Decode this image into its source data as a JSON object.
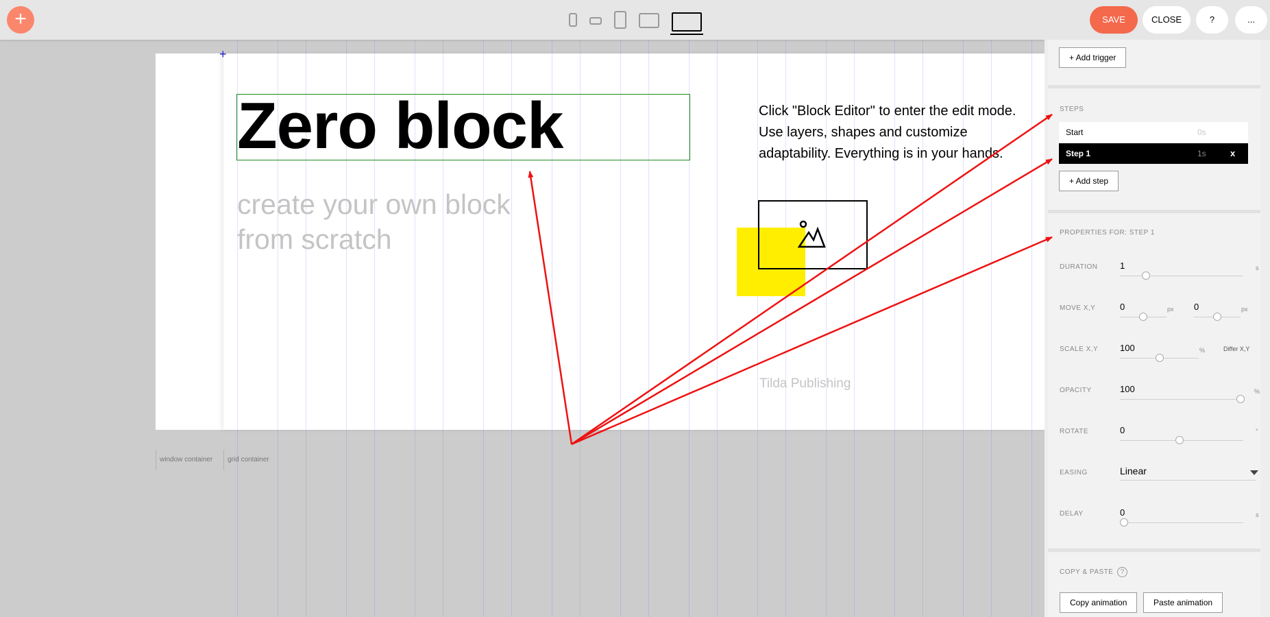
{
  "toolbar": {
    "add_icon": "plus-icon",
    "add_glyph": "+",
    "devices": [
      "phone-portrait-icon",
      "phone-landscape-icon",
      "tablet-portrait-icon",
      "tablet-landscape-icon",
      "desktop-icon"
    ],
    "save_label": "SAVE",
    "close_label": "CLOSE",
    "help_label": "?",
    "more_label": "...",
    "accent_color": "#f4684c"
  },
  "canvas": {
    "crosshair_glyph": "+",
    "title": "Zero block",
    "subtitle": "create your own block from scratch",
    "description": "Click \"Block Editor\" to enter the edit mode. Use layers, shapes and customize adaptability. Everything is in your hands.",
    "footer_text": "Tilda Publishing",
    "shape_color": "#ffee00",
    "window_container_label": "window container",
    "grid_container_label": "grid container"
  },
  "panel": {
    "add_trigger_label": "+ Add trigger",
    "steps_title": "STEPS",
    "steps": [
      {
        "name": "Start",
        "time": "0s"
      },
      {
        "name": "Step 1",
        "time": "1s",
        "delete": "x"
      }
    ],
    "add_step_label": "+ Add step",
    "properties_title": "PROPERTIES FOR: STEP 1",
    "duration": {
      "label": "DURATION",
      "value": "1",
      "unit": "s"
    },
    "move": {
      "label": "MOVE X,Y",
      "x": "0",
      "y": "0",
      "unit": "px"
    },
    "scale": {
      "label": "SCALE X,Y",
      "value": "100",
      "unit": "%",
      "differ_label": "Differ X,Y"
    },
    "opacity": {
      "label": "OPACITY",
      "value": "100",
      "unit": "%"
    },
    "rotate": {
      "label": "ROTATE",
      "value": "0",
      "unit": "°"
    },
    "easing": {
      "label": "EASING",
      "value": "Linear"
    },
    "delay": {
      "label": "DELAY",
      "value": "0",
      "unit": "s"
    },
    "copy_paste_title": "COPY & PASTE",
    "copy_paste_help": "?",
    "copy_label": "Copy animation",
    "paste_label": "Paste animation"
  }
}
